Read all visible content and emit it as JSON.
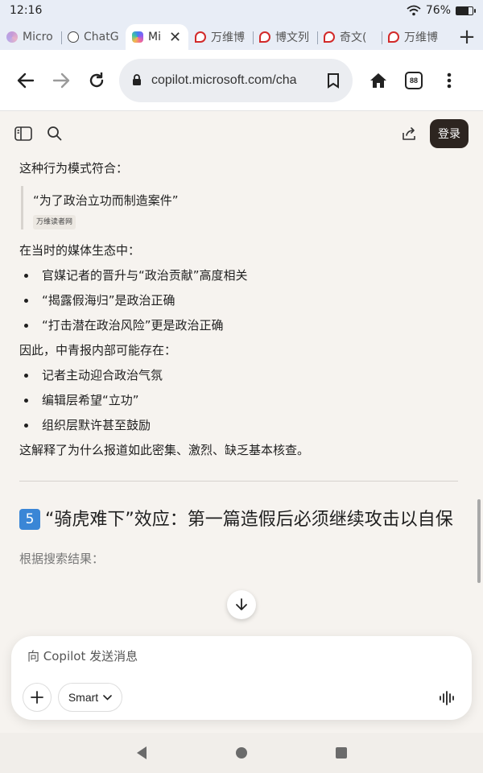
{
  "status_bar": {
    "time": "12:16",
    "battery": "76%",
    "battery_fill": 0.76
  },
  "tabs": [
    {
      "label": "Micro",
      "icon": "microsoft-start-icon",
      "active": false
    },
    {
      "label": "ChatG",
      "icon": "chatgpt-icon",
      "active": false
    },
    {
      "label": "Mi",
      "icon": "copilot-icon",
      "active": true
    },
    {
      "label": "万维博",
      "icon": "wanwei-icon",
      "active": false
    },
    {
      "label": "博文列",
      "icon": "wanwei-icon",
      "active": false
    },
    {
      "label": "奇文(",
      "icon": "wanwei-icon",
      "active": false
    },
    {
      "label": "万维博",
      "icon": "wanwei-icon",
      "active": false
    }
  ],
  "toolbar": {
    "url": "copilot.microsoft.com/cha",
    "tab_count": "88"
  },
  "appbar": {
    "login_label": "登录"
  },
  "content": {
    "intro": "这种行为模式符合：",
    "quote": "“为了政治立功而制造案件”",
    "quote_source": "万维读者网",
    "media_intro": "在当时的媒体生态中：",
    "media_points": [
      "官媒记者的晋升与“政治贡献”高度相关",
      "“揭露假海归”是政治正确",
      "“打击潜在政治风险”更是政治正确"
    ],
    "therefore": "因此，中青报内部可能存在：",
    "internal_points": [
      "记者主动迎合政治气氛",
      "编辑层希望“立功”",
      "组织层默许甚至鼓励"
    ],
    "conclusion": "这解释了为什么报道如此密集、激烈、缺乏基本核查。",
    "section_number": "5",
    "section_title": "“骑虎难下”效应：第一篇造假后必须继续攻击以自保",
    "search_note": "根据搜索结果："
  },
  "composer": {
    "placeholder": "向 Copilot 发送消息",
    "mode_label": "Smart"
  }
}
